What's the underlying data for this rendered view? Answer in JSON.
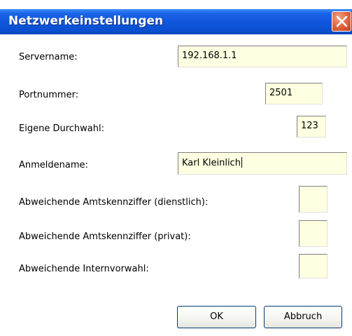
{
  "window": {
    "title": "Netzwerkeinstellungen"
  },
  "fields": {
    "servername": {
      "label": "Servername:",
      "value": "192.168.1.1"
    },
    "portnummer": {
      "label": "Portnummer:",
      "value": "2501"
    },
    "durchwahl": {
      "label": "Eigene Durchwahl:",
      "value": "123"
    },
    "anmeldename": {
      "label": "Anmeldename:",
      "value": "Karl Kleinlich"
    },
    "amt_dienstlich": {
      "label": "Abweichende Amtskennziffer (dienstlich):",
      "value": ""
    },
    "amt_privat": {
      "label": "Abweichende Amtskennziffer (privat):",
      "value": ""
    },
    "internvorwahl": {
      "label": "Abweichende Internvorwahl:",
      "value": ""
    }
  },
  "buttons": {
    "ok": "OK",
    "cancel": "Abbruch"
  },
  "colors": {
    "titlebar": "#0a4fd0",
    "close": "#e46a45",
    "field_bg": "#ffffe1"
  }
}
